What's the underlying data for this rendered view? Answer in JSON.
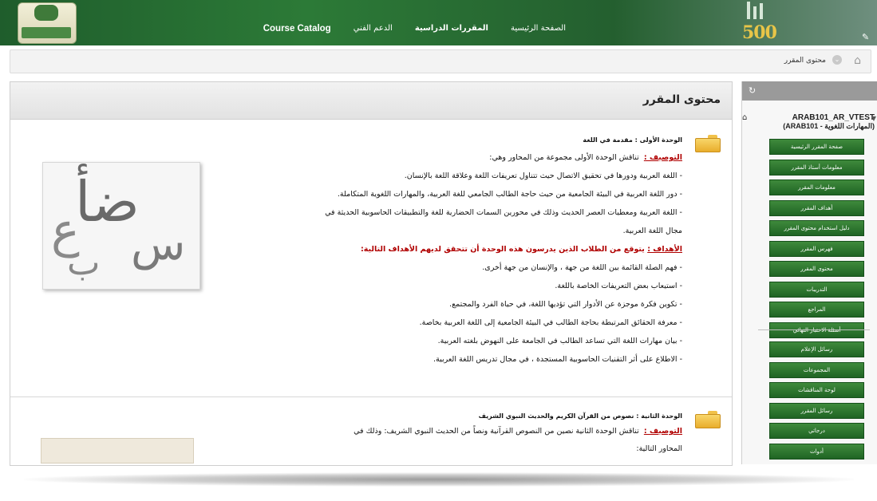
{
  "header": {
    "nav": [
      "الصفحة الرئيسية",
      "المقررات الدراسية",
      "الدعم الفني",
      "Course Catalog"
    ],
    "emblem_text": "500"
  },
  "breadcrumb": {
    "current": "محتوى المقرر"
  },
  "main": {
    "title": "محتوى المقرر",
    "unit1": {
      "title": "الوحدة الأولى : مقدمة في اللغة",
      "desc_label": "التوصيف :",
      "desc_text": "تناقش الوحدة الأولى مجموعة من المحاور وهي:",
      "points": [
        "- اللغة العربية ودورها في تحقيق الاتصال حيث تتناول تعريفات اللغة وعلاقة اللغة بالإنسان.",
        "- دور اللغة العربية في البيئة الجامعية من حيث حاجة الطالب الجامعي للغة العربية، والمهارات اللغوية المتكاملة.",
        "- اللغة العربية ومعطيات العصر الحديث وذلك في محورين السمات الحضارية للغة والتطبيقات الحاسوبية الحديثة في",
        "مجال اللغة العربية."
      ],
      "goals_label": "الأهداف :",
      "goals_text": "يتوقع من الطلاب الذين يدرسون هذه الوحدة أن تتحقق لديهم الأهداف التالية:",
      "goals": [
        "- فهم الصلة القائمة بين اللغة من جهة ، والإنسان من جهة أخرى.",
        "- استيعاب بعض التعريفات الخاصة باللغة.",
        "- تكوين فكرة موجزة عن الأدوار التي تؤديها اللغة، في حياة الفرد والمجتمع.",
        "- معرفة الحقائق المرتبطة بحاجة الطالب في البيئة الجامعية إلى اللغة العربية بخاصة.",
        "- بيان مهارات اللغة التي تساعد الطالب في الجامعة على النهوض بلغته العربية.",
        "- الاطلاع على أثر التقنيات الحاسوبية المستجدة ، في مجال تدريس اللغة العربية."
      ]
    },
    "unit2": {
      "title": "الوحدة الثانية : نصوص من القرآن الكريم والحديث النبوي الشريف",
      "desc_label": "التوصيف :",
      "desc_text": "تناقش الوحدة الثانية نصين من النصوص القرآنية ونصاً من الحديث النبوي الشريف: وذلك في",
      "next_line": "المحاور التالية:"
    },
    "image_glyphs": "ضأ ع س و ب"
  },
  "sidebar": {
    "course_code": "ARAB101_AR_VTEST",
    "course_code_sub": "(ARAB101 - المهارات اللغوية)",
    "menu1": [
      "صفحة المقرر الرئيسية",
      "معلومات أستاذ المقرر",
      "معلومات المقرر",
      "أهداف المقرر",
      "دليل استخدام محتوى المقرر",
      "فهرس المقرر",
      "محتوى المقرر",
      "التدريبات",
      "المراجع",
      "أسئلة الاختبار النهائي"
    ],
    "menu2": [
      "رسائل الإعلام",
      "المجموعات",
      "لوحة المناقشات",
      "رسائل المقرر",
      "درجاتي",
      "أدوات"
    ]
  }
}
